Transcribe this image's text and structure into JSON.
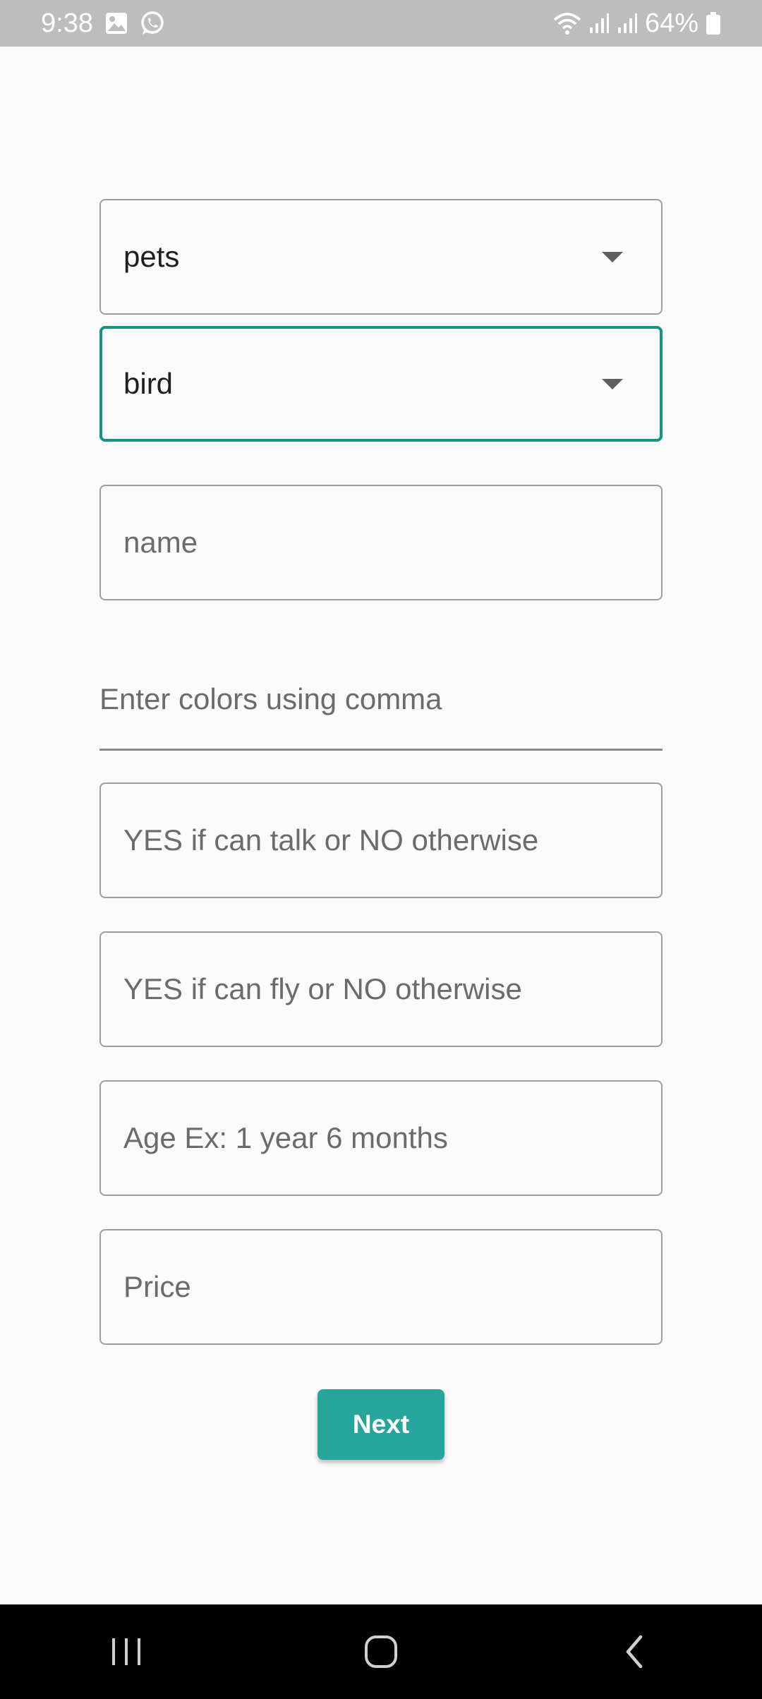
{
  "status_bar": {
    "time": "9:38",
    "battery": "64%",
    "icons": [
      "gallery-icon",
      "whatsapp-icon",
      "wifi-icon",
      "signal-icon",
      "signal-icon",
      "battery-icon"
    ]
  },
  "form": {
    "category_select": {
      "value": "pets"
    },
    "type_select": {
      "value": "bird"
    },
    "name_input": {
      "placeholder": "name"
    },
    "colors_input": {
      "placeholder": "Enter colors using comma"
    },
    "talk_input": {
      "placeholder": "YES if can talk or NO otherwise"
    },
    "fly_input": {
      "placeholder": "YES if can fly or NO otherwise"
    },
    "age_input": {
      "placeholder": "Age Ex: 1 year 6 months"
    },
    "price_input": {
      "placeholder": "Price"
    },
    "next_label": "Next"
  },
  "colors": {
    "accent": "#26a69a",
    "focus_border": "#139582",
    "status_bar": "#bdbdbd",
    "background": "#fafafa"
  },
  "nav_bar": {
    "icons": [
      "recent-apps-icon",
      "home-icon",
      "back-icon"
    ]
  }
}
